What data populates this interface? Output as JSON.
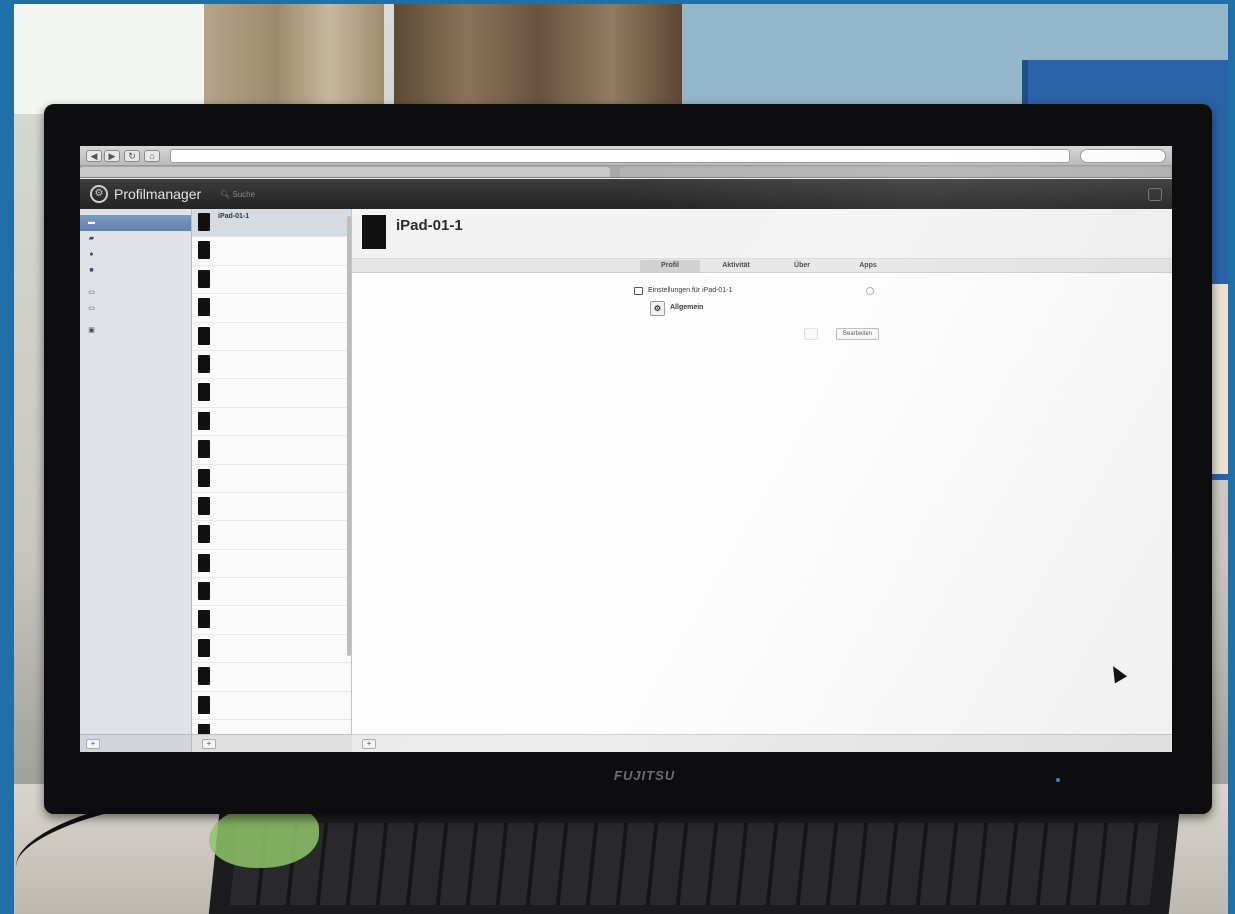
{
  "app": {
    "title": "Profilmanager",
    "search_placeholder": "Suche"
  },
  "browser": {
    "url": "",
    "tab_active": "",
    "tab_other": ""
  },
  "header": {
    "admin_button": ""
  },
  "sidebar": {
    "sections": [
      "",
      "",
      ""
    ],
    "items": [
      {
        "label": "",
        "icon": "device-icon",
        "active": true
      },
      {
        "label": "",
        "icon": "group-icon",
        "active": false
      },
      {
        "label": "",
        "icon": "user-icon",
        "active": false
      },
      {
        "label": "",
        "icon": "groups-icon",
        "active": false
      },
      {
        "label": "",
        "icon": "device-icon",
        "active": false
      },
      {
        "label": "",
        "icon": "device-icon",
        "active": false
      },
      {
        "label": "",
        "icon": "device-icon",
        "active": false
      }
    ]
  },
  "devices": [
    {
      "name": "iPad-01-1",
      "sub": "",
      "selected": true
    },
    {
      "name": "",
      "sub": ""
    },
    {
      "name": "",
      "sub": ""
    },
    {
      "name": "",
      "sub": ""
    },
    {
      "name": "",
      "sub": ""
    },
    {
      "name": "",
      "sub": ""
    },
    {
      "name": "",
      "sub": ""
    },
    {
      "name": "",
      "sub": ""
    },
    {
      "name": "",
      "sub": ""
    },
    {
      "name": "",
      "sub": ""
    },
    {
      "name": "",
      "sub": ""
    },
    {
      "name": "",
      "sub": ""
    },
    {
      "name": "",
      "sub": ""
    },
    {
      "name": "",
      "sub": ""
    },
    {
      "name": "",
      "sub": ""
    },
    {
      "name": "",
      "sub": ""
    },
    {
      "name": "",
      "sub": ""
    },
    {
      "name": "",
      "sub": ""
    },
    {
      "name": "",
      "sub": ""
    }
  ],
  "detail": {
    "title": "iPad-01-1",
    "subtitle": "",
    "tabs": [
      "Profil",
      "Aktivität",
      "Über",
      "Apps"
    ],
    "active_tab": "Profil",
    "settings_label": "Einstellungen für iPad-01-1",
    "general_label": "Allgemein",
    "cancel_label": "",
    "edit_label": "Bearbeiten"
  },
  "monitor": {
    "brand": "FUJITSU"
  }
}
